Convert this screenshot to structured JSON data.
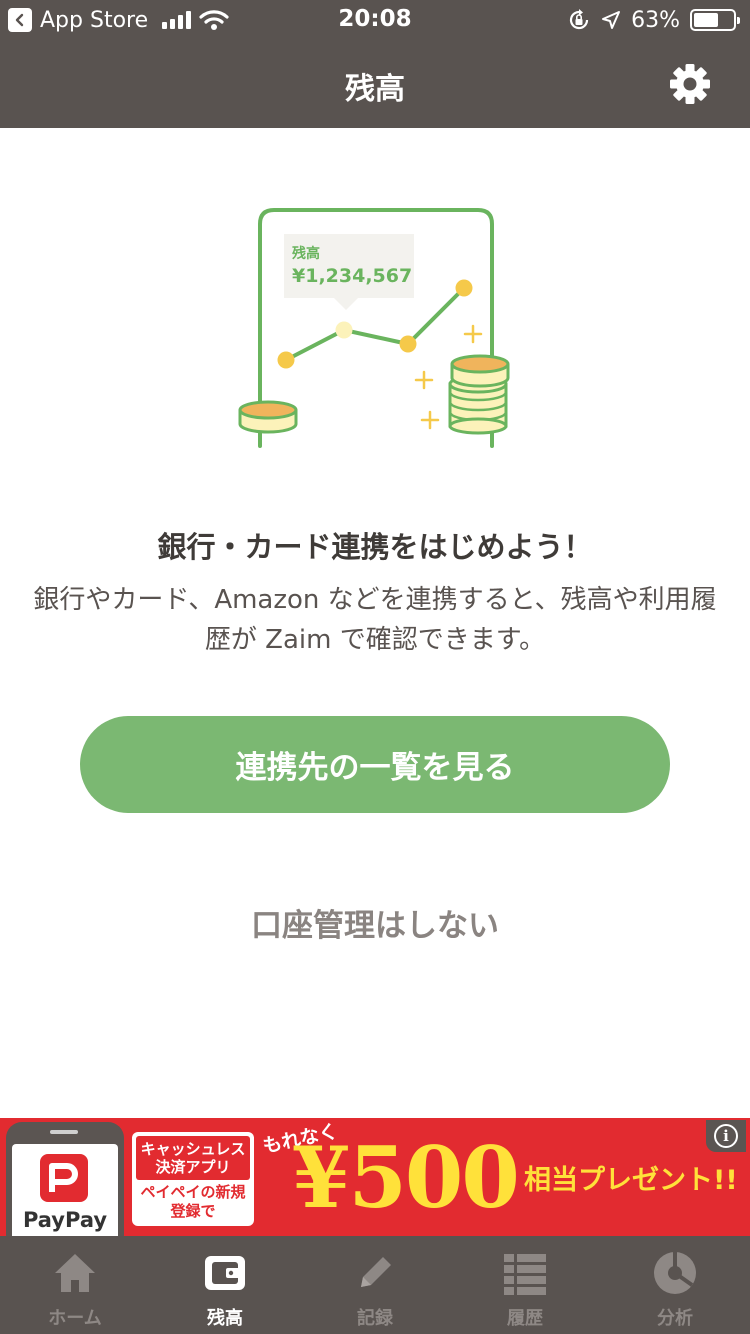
{
  "status_bar": {
    "back_app": "App Store",
    "time": "20:08",
    "battery": "63%",
    "battery_level": 0.63
  },
  "nav": {
    "title": "残高",
    "settings_icon": "gear-icon"
  },
  "illustration": {
    "label": "残高",
    "amount": "¥1,234,567",
    "colors": {
      "green": "#6ab45e",
      "yellow": "#f5c94a",
      "coin_light": "#fcf2ba"
    }
  },
  "main": {
    "heading": "銀行・カード連携をはじめよう！",
    "description": "銀行やカード、Amazon などを連携すると、残高や利用履歴が Zaim で確認できます。",
    "cta_label": "連携先の一覧を見る",
    "skip_label": "口座管理はしない"
  },
  "ad": {
    "brand": "PayPay",
    "box_top": "キャッシュレス決済アプリ",
    "box_bottom": "ペイペイの新規登録で",
    "tagline": "もれなく",
    "price": "¥500",
    "present": "相当プレゼント!!",
    "info_icon": "i"
  },
  "tabs": [
    {
      "label": "ホーム",
      "icon": "home-icon",
      "active": false
    },
    {
      "label": "残高",
      "icon": "wallet-icon",
      "active": true
    },
    {
      "label": "記録",
      "icon": "pencil-icon",
      "active": false
    },
    {
      "label": "履歴",
      "icon": "list-icon",
      "active": false
    },
    {
      "label": "分析",
      "icon": "pie-chart-icon",
      "active": false
    }
  ],
  "colors": {
    "header_bg": "#595350",
    "accent_green": "#7bb872",
    "ad_red": "#e22b30",
    "ad_yellow": "#ffe13a"
  }
}
